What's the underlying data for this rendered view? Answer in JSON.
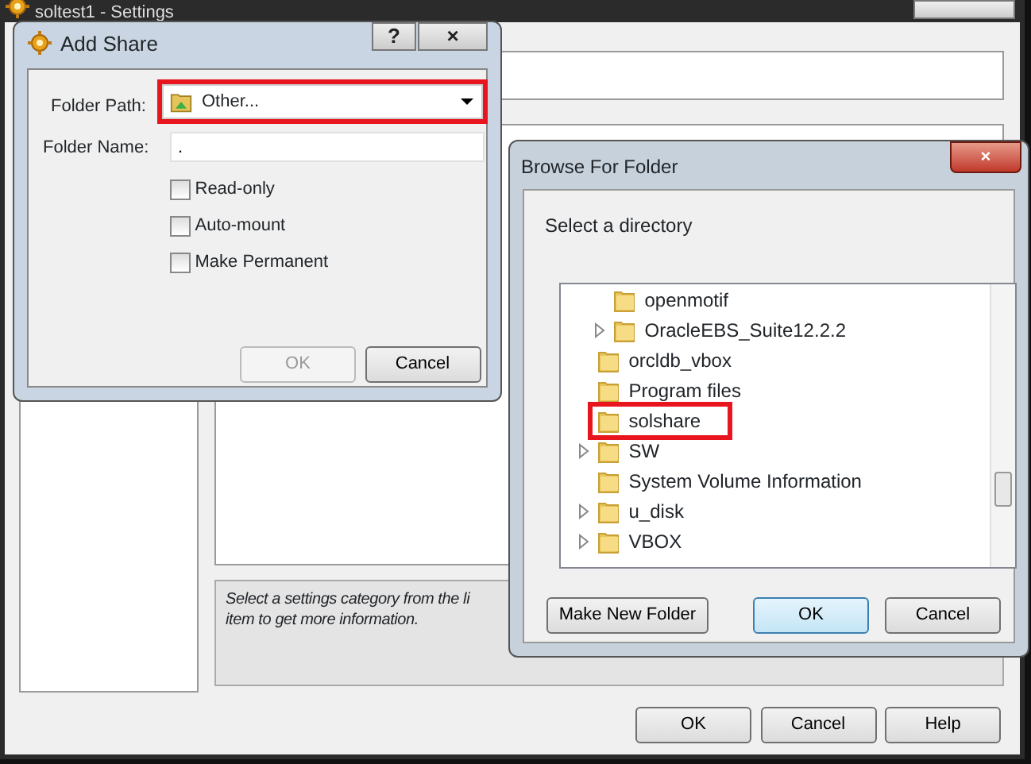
{
  "settings_window": {
    "title": "soltest1 - Settings",
    "info_text": [
      "Select a settings category from the li",
      "item to get more information."
    ],
    "buttons": [
      {
        "label": "OK"
      },
      {
        "label": "Cancel"
      },
      {
        "label": "Help"
      }
    ]
  },
  "add_share": {
    "title": "Add Share",
    "help_button": "?",
    "close_button": "×",
    "folder_path": {
      "label": "Folder Path:",
      "value": "Other...",
      "highlighted": true
    },
    "folder_name": {
      "label": "Folder Name:",
      "value": "."
    },
    "options": [
      {
        "label": "Read-only",
        "checked": false
      },
      {
        "label": "Auto-mount",
        "checked": false
      },
      {
        "label": "Make Permanent",
        "checked": false
      }
    ],
    "buttons": [
      {
        "label": "OK",
        "disabled": true
      },
      {
        "label": "Cancel",
        "disabled": false
      }
    ]
  },
  "browse_folder": {
    "title": "Browse For Folder",
    "close_button": "×",
    "prompt": "Select a directory",
    "tree": {
      "nested_items": [
        {
          "label": "openmotif",
          "expandable": false,
          "highlighted": false
        },
        {
          "label": "OracleEBS_Suite12.2.2",
          "expandable": true,
          "highlighted": false
        }
      ],
      "items": [
        {
          "label": "orcldb_vbox",
          "expandable": false,
          "highlighted": false
        },
        {
          "label": "Program files",
          "expandable": false,
          "highlighted": false
        },
        {
          "label": "solshare",
          "expandable": false,
          "highlighted": true
        },
        {
          "label": "SW",
          "expandable": true,
          "highlighted": false
        },
        {
          "label": "System Volume Information",
          "expandable": false,
          "highlighted": false
        },
        {
          "label": "u_disk",
          "expandable": true,
          "highlighted": false
        },
        {
          "label": "VBOX",
          "expandable": true,
          "highlighted": false
        }
      ]
    },
    "buttons": [
      {
        "label": "Make New Folder",
        "default": false
      },
      {
        "label": "OK",
        "default": true
      },
      {
        "label": "Cancel",
        "default": false
      }
    ]
  }
}
